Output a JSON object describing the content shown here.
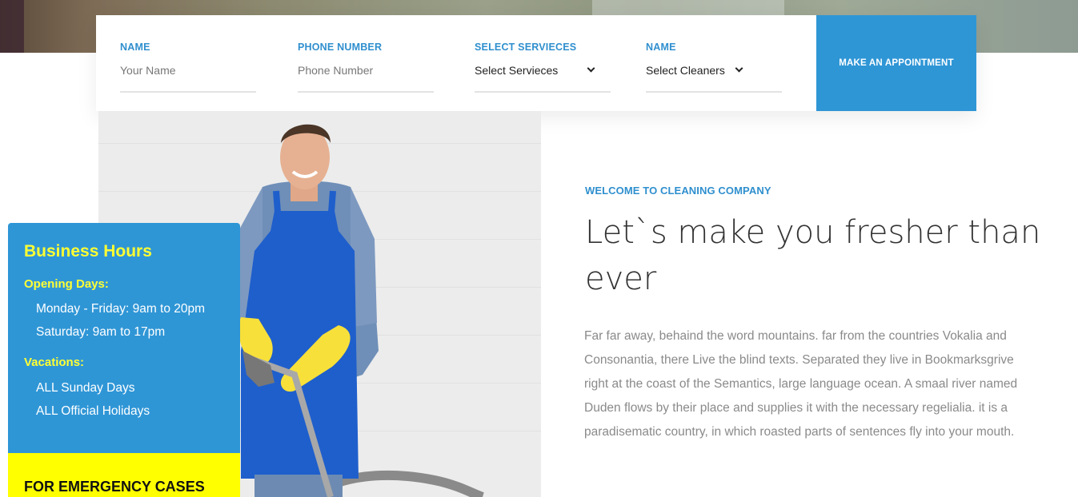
{
  "form": {
    "name_label": "NAME",
    "name_placeholder": "Your Name",
    "phone_label": "PHONE NUMBER",
    "phone_placeholder": "Phone Number",
    "service_label": "SELECT SERVIECES",
    "service_value": "Select Servieces",
    "cleaner_label": "NAME",
    "cleaner_value": "Select Cleaners",
    "submit_label": "MAKE AN APPOINTMENT"
  },
  "hours": {
    "title": "Business Hours",
    "opening_label": "Opening Days:",
    "opening_rows": [
      "Monday - Friday: 9am to 20pm",
      "Saturday: 9am to 17pm"
    ],
    "vacations_label": "Vacations:",
    "vacation_rows": [
      "ALL Sunday Days",
      "ALL Official Holidays"
    ],
    "emergency": "FOR EMERGENCY CASES"
  },
  "welcome": {
    "kicker": "WELCOME TO CLEANING COMPANY",
    "headline": "Let`s make you fresher than ever",
    "body": "Far far away, behaind the word mountains. far from the countries Vokalia and Consonantia, there Live the blind texts. Separated they live in Bookmarksgrive right at the coast of the Semantics, large language ocean. A smaal river named Duden flows by their place and supplies it with the necessary regelialia. it is a paradisematic country, in which roasted parts of sentences fly into your mouth."
  },
  "colors": {
    "accent_blue": "#2f96d6",
    "highlight_yellow": "#ffff33",
    "emergency_yellow": "#ffff00"
  },
  "icons": {
    "select_chevron": "chevron-down-icon"
  }
}
